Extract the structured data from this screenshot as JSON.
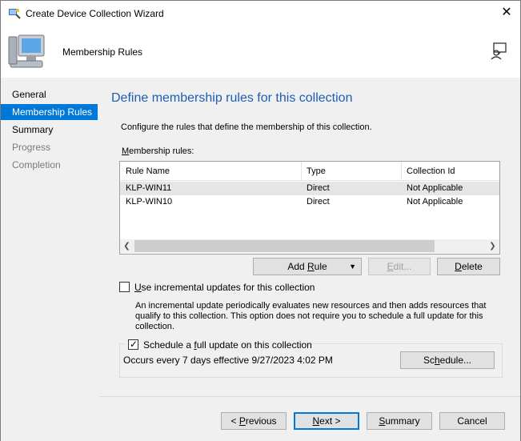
{
  "window": {
    "title": "Create Device Collection Wizard",
    "close_symbol": "✕"
  },
  "header": {
    "page_title": "Membership Rules"
  },
  "nav": {
    "items": [
      {
        "label": "General",
        "state": "normal"
      },
      {
        "label": "Membership Rules",
        "state": "active"
      },
      {
        "label": "Summary",
        "state": "normal"
      },
      {
        "label": "Progress",
        "state": "disabled"
      },
      {
        "label": "Completion",
        "state": "disabled"
      }
    ]
  },
  "content": {
    "heading": "Define membership rules for this collection",
    "description": "Configure the rules that define the membership of this collection.",
    "rules_label_accel": "M",
    "rules_label_rest": "embership rules:",
    "table": {
      "columns": [
        "Rule Name",
        "Type",
        "Collection Id"
      ],
      "rows": [
        [
          "KLP-WIN11",
          "Direct",
          "Not Applicable"
        ],
        [
          "KLP-WIN10",
          "Direct",
          "Not Applicable"
        ]
      ]
    },
    "buttons": {
      "add_rule_pre": "Add ",
      "add_rule_accel": "R",
      "add_rule_post": "ule",
      "edit_accel": "E",
      "edit_post": "dit...",
      "delete_accel": "D",
      "delete_post": "elete"
    },
    "incremental": {
      "accel": "U",
      "label_rest": "se incremental updates for this collection",
      "checked": false,
      "note": "An incremental update periodically evaluates new resources and then adds resources that qualify to this collection. This option does not require you to schedule a full update for this collection."
    },
    "schedule": {
      "label_pre": "Schedule a ",
      "accel": "f",
      "label_post": "ull update on this collection",
      "checked": true,
      "occurs": "Occurs every 7 days effective 9/27/2023 4:02 PM",
      "button_pre": "Sc",
      "button_accel": "h",
      "button_post": "edule..."
    }
  },
  "footer": {
    "previous_pre": "< ",
    "previous_accel": "P",
    "previous_post": "revious",
    "next_accel": "N",
    "next_post": "ext >",
    "summary_accel": "S",
    "summary_post": "ummary",
    "cancel": "Cancel"
  },
  "colors": {
    "accent": "#0078d7",
    "heading": "#1a5fb4",
    "panel": "#f0f0f0"
  }
}
